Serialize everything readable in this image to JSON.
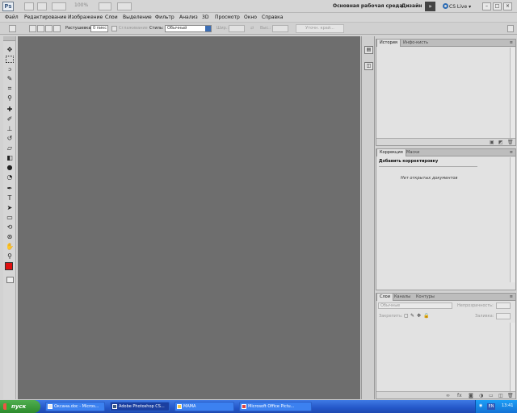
{
  "app": {
    "logo": "Ps",
    "zoom": "100%",
    "workspace": "Основная рабочая среда",
    "design": "Дизайн",
    "expand": "»",
    "cslive": "CS Live",
    "win_min": "–",
    "win_max": "□",
    "win_close": "×"
  },
  "menu": [
    "Файл",
    "Редактирование",
    "Изображение",
    "Слои",
    "Выделение",
    "Фильтр",
    "Анализ",
    "3D",
    "Просмотр",
    "Окно",
    "Справка"
  ],
  "options": {
    "feather_label": "Растушевка:",
    "feather_value": "0 пикс",
    "antialias_label": "Сглаживание",
    "style_label": "Стиль:",
    "style_value": "Обычный",
    "width_label": "Шир.:",
    "height_label": "Выс.:",
    "refine_label": "Уточн. край..."
  },
  "panels": {
    "history_tabs": [
      "История",
      "Инфо-кисть"
    ],
    "corrections_tabs": [
      "Коррекция",
      "Маски"
    ],
    "add_adjustment": "Добавить корректировку",
    "no_documents": "Нет открытых документов",
    "layers_tabs": [
      "Слои",
      "Каналы",
      "Контуры"
    ],
    "blend_mode": "Обычные",
    "opacity_label": "Непрозрачность:",
    "lock_label": "Закрепить:",
    "fill_label": "Заливка:",
    "panel_menu": "≡"
  },
  "taskbar": {
    "start": "пуск",
    "tasks": [
      "Оксана.doc - Micros...",
      "Adobe Photoshop CS...",
      "МАМА",
      "Microsoft Office Pictu..."
    ],
    "lang": "EN",
    "time": "13:41"
  },
  "colors": {
    "foreground": "#e01010",
    "background": "#ffffff",
    "canvas": "#6e6e6e"
  }
}
